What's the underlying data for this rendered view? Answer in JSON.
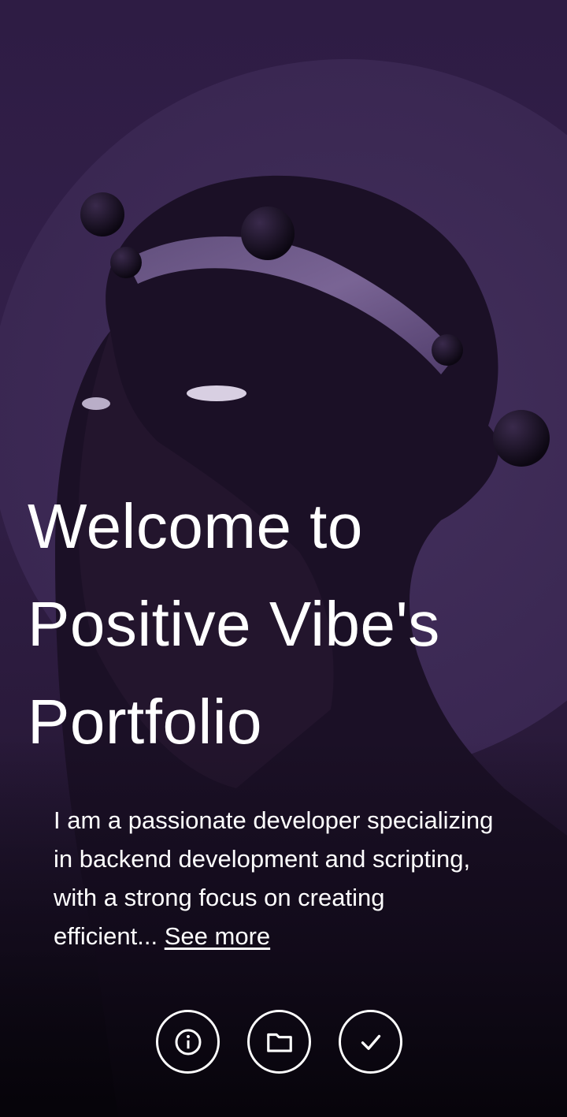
{
  "hero": {
    "title_line1": "Welcome to",
    "title_line2": "Positive Vibe's",
    "title_line3": "Portfolio",
    "bio_text": "I am a passionate developer specializing in backend development and scripting, with a strong focus on creating efficient... ",
    "see_more_label": "See more"
  },
  "actions": [
    {
      "icon": "info-icon"
    },
    {
      "icon": "folder-icon"
    },
    {
      "icon": "check-icon"
    }
  ],
  "colors": {
    "background": "#2e1c44",
    "halo": "#3e2a55",
    "text": "#ffffff"
  }
}
